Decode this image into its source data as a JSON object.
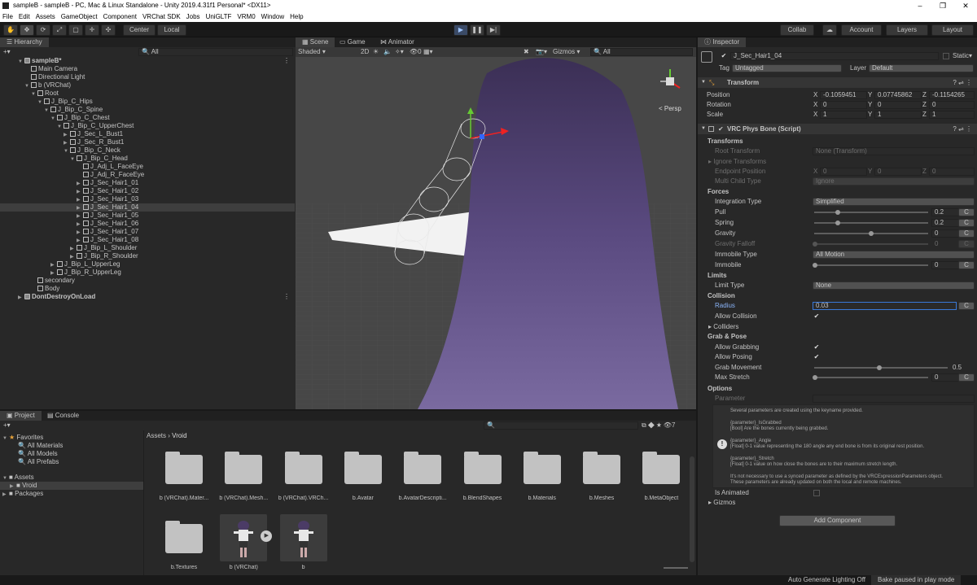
{
  "window": {
    "title": "sampleB - sampleB - PC, Mac & Linux Standalone - Unity 2019.4.31f1 Personal* <DX11>",
    "min": "–",
    "max": "❐",
    "close": "✕"
  },
  "menu": [
    "File",
    "Edit",
    "Assets",
    "GameObject",
    "Component",
    "VRChat SDK",
    "Jobs",
    "UniGLTF",
    "VRM0",
    "Window",
    "Help"
  ],
  "toolbar": {
    "center": "Center",
    "local": "Local",
    "collab": "Collab",
    "account": "Account",
    "layers": "Layers",
    "layout": "Layout"
  },
  "hierarchy": {
    "tab": "Hierarchy",
    "search": "All",
    "rows": [
      {
        "t": "sampleB*",
        "d": 0,
        "a": "▼",
        "icon": "scene"
      },
      {
        "t": "Main Camera",
        "d": 1,
        "a": ""
      },
      {
        "t": "Directional Light",
        "d": 1,
        "a": ""
      },
      {
        "t": "b (VRChat)",
        "d": 1,
        "a": "▼"
      },
      {
        "t": "Root",
        "d": 2,
        "a": "▼"
      },
      {
        "t": "J_Bip_C_Hips",
        "d": 3,
        "a": "▼"
      },
      {
        "t": "J_Bip_C_Spine",
        "d": 4,
        "a": "▼"
      },
      {
        "t": "J_Bip_C_Chest",
        "d": 5,
        "a": "▼"
      },
      {
        "t": "J_Bip_C_UpperChest",
        "d": 6,
        "a": "▼"
      },
      {
        "t": "J_Sec_L_Bust1",
        "d": 7,
        "a": "▶"
      },
      {
        "t": "J_Sec_R_Bust1",
        "d": 7,
        "a": "▶"
      },
      {
        "t": "J_Bip_C_Neck",
        "d": 7,
        "a": "▼"
      },
      {
        "t": "J_Bip_C_Head",
        "d": 8,
        "a": "▼"
      },
      {
        "t": "J_Adj_L_FaceEye",
        "d": 9,
        "a": ""
      },
      {
        "t": "J_Adj_R_FaceEye",
        "d": 9,
        "a": ""
      },
      {
        "t": "J_Sec_Hair1_01",
        "d": 9,
        "a": "▶"
      },
      {
        "t": "J_Sec_Hair1_02",
        "d": 9,
        "a": "▶"
      },
      {
        "t": "J_Sec_Hair1_03",
        "d": 9,
        "a": "▶"
      },
      {
        "t": "J_Sec_Hair1_04",
        "d": 9,
        "a": "▶",
        "sel": true
      },
      {
        "t": "J_Sec_Hair1_05",
        "d": 9,
        "a": "▶"
      },
      {
        "t": "J_Sec_Hair1_06",
        "d": 9,
        "a": "▶"
      },
      {
        "t": "J_Sec_Hair1_07",
        "d": 9,
        "a": "▶"
      },
      {
        "t": "J_Sec_Hair1_08",
        "d": 9,
        "a": "▶"
      },
      {
        "t": "J_Bip_L_Shoulder",
        "d": 8,
        "a": "▶"
      },
      {
        "t": "J_Bip_R_Shoulder",
        "d": 8,
        "a": "▶"
      },
      {
        "t": "J_Bip_L_UpperLeg",
        "d": 5,
        "a": "▶"
      },
      {
        "t": "J_Bip_R_UpperLeg",
        "d": 5,
        "a": "▶"
      },
      {
        "t": "secondary",
        "d": 2,
        "a": ""
      },
      {
        "t": "Body",
        "d": 2,
        "a": ""
      },
      {
        "t": "DontDestroyOnLoad",
        "d": 0,
        "a": "▶",
        "icon": "scene"
      }
    ]
  },
  "scene": {
    "tabs": [
      "Scene",
      "Game",
      "Animator"
    ],
    "shading": "Shaded",
    "mode2d": "2D",
    "gizmos": "Gizmos",
    "search": "All",
    "persp": "< Persp",
    "layers_count": "0"
  },
  "inspector": {
    "tab": "Inspector",
    "name": "J_Sec_Hair1_04",
    "static": "Static",
    "tag_label": "Tag",
    "tag": "Untagged",
    "layer_label": "Layer",
    "layer": "Default",
    "transform": {
      "title": "Transform",
      "position_label": "Position",
      "rotation_label": "Rotation",
      "scale_label": "Scale",
      "px": "-0.1059451",
      "py": "0.07745862",
      "pz": "-0.1154265",
      "rx": "0",
      "ry": "0",
      "rz": "0",
      "sx": "1",
      "sy": "1",
      "sz": "1"
    },
    "physbone": {
      "title": "VRC Phys Bone (Script)",
      "transforms": "Transforms",
      "root_transform": "Root Transform",
      "root_value": "None (Transform)",
      "ignore_transforms": "Ignore Transforms",
      "endpoint_position": "Endpoint Position",
      "ex": "0",
      "ey": "0",
      "ez": "0",
      "multi_child": "Multi Child Type",
      "multi_value": "Ignore",
      "forces": "Forces",
      "integration": "Integration Type",
      "integration_value": "Simplified",
      "pull": "Pull",
      "pull_value": "0.2",
      "spring": "Spring",
      "spring_value": "0.2",
      "gravity": "Gravity",
      "gravity_value": "0",
      "gravity_falloff": "Gravity Falloff",
      "falloff_value": "0",
      "immobile_type": "Immobile Type",
      "immobile_type_value": "All Motion",
      "immobile": "Immobile",
      "immobile_value": "0",
      "limits": "Limits",
      "limit_type": "Limit Type",
      "limit_value": "None",
      "collision": "Collision",
      "radius": "Radius",
      "radius_value": "0.03",
      "allow_collision": "Allow Collision",
      "colliders": "Colliders",
      "grab_pose": "Grab & Pose",
      "allow_grabbing": "Allow Grabbing",
      "allow_posing": "Allow Posing",
      "grab_movement": "Grab Movement",
      "grab_value": "0.5",
      "max_stretch": "Max Stretch",
      "stretch_value": "0",
      "options": "Options",
      "parameter": "Parameter",
      "help1": "Several parameters are created using the keyname provided.",
      "help2": "{parameter}_IsGrabbed",
      "help3": "[Bool] Are the bones currently being grabbed.",
      "help4": "{parameter}_Angle",
      "help5": "[Float] 0-1 value representing the 180 angle any end bone is from its original rest position.",
      "help6": "{parameter}_Stretch",
      "help7": "[Float] 0-1 value on how close the bones are to their maximum stretch length.",
      "help8": "It's not necessary to use a synced parameter as defined by the VRCExpressionParameters object.",
      "help9": "These parameters are already updated on both the local and remote machines.",
      "is_animated": "Is Animated",
      "gizmos": "Gizmos",
      "c": "C"
    },
    "add_component": "Add Component"
  },
  "project": {
    "tabs": [
      "Project",
      "Console"
    ],
    "favorites": "Favorites",
    "fav_items": [
      "All Materials",
      "All Models",
      "All Prefabs"
    ],
    "assets": "Assets",
    "vroid": "Vroid",
    "packages": "Packages",
    "crumb_assets": "Assets",
    "crumb_sep": "›",
    "crumb_vroid": "Vroid",
    "items": [
      "b (VRChat).Mater...",
      "b (VRChat).Mesh...",
      "b (VRChat).VRCh...",
      "b.Avatar",
      "b.AvatarDescripti...",
      "b.BlendShapes",
      "b.Materials",
      "b.Meshes",
      "b.MetaObject",
      "b.Textures",
      "b (VRChat)",
      "b"
    ],
    "counter": "7"
  },
  "status": {
    "lighting": "Auto Generate Lighting Off",
    "bake": "Bake paused in play mode"
  }
}
